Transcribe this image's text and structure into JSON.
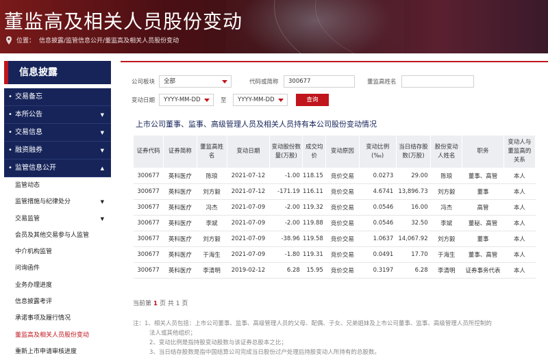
{
  "banner": {
    "title": "董监高及相关人员股份变动",
    "location_label": "位置：",
    "breadcrumb": "信息披露/监管信息公开/董监高及相关人员股份变动"
  },
  "sidebar": {
    "header": "信息披露",
    "main_items": [
      {
        "label": "交易备忘",
        "arrow": ""
      },
      {
        "label": "本所公告",
        "arrow": "▼"
      },
      {
        "label": "交易信息",
        "arrow": "▼"
      },
      {
        "label": "融资融券",
        "arrow": "▼"
      },
      {
        "label": "监管信息公开",
        "arrow": "▲"
      }
    ],
    "sub_items": [
      {
        "label": "监管动态",
        "arrow": ""
      },
      {
        "label": "监管措施与纪律处分",
        "arrow": "▼"
      },
      {
        "label": "交易监管",
        "arrow": "▼"
      },
      {
        "label": "会员及其他交易参与人监管",
        "arrow": ""
      },
      {
        "label": "中介机构监管",
        "arrow": ""
      },
      {
        "label": "问询函件",
        "arrow": ""
      },
      {
        "label": "业务办理进度",
        "arrow": ""
      },
      {
        "label": "信息披露考评",
        "arrow": ""
      },
      {
        "label": "承诺事项及履行情况",
        "arrow": ""
      },
      {
        "label": "董监高及相关人员股份变动",
        "arrow": ""
      },
      {
        "label": "重新上市申请审核进度",
        "arrow": ""
      }
    ],
    "active_sub": "董监高及相关人员股份变动"
  },
  "form": {
    "board_label": "公司板块",
    "board_value": "全部",
    "code_label": "代码或简称",
    "code_value": "300677",
    "name_label": "董监高姓名",
    "name_value": "",
    "date_label": "变动日期",
    "date_from": "YYYY-MM-DD",
    "to_label": "至",
    "date_to": "YYYY-MM-DD",
    "query_button": "查询"
  },
  "section_title": "上市公司董事、监事、高级管理人员及相关人员持有本公司股份变动情况",
  "table": {
    "headers": [
      "证券代码",
      "证券简称",
      "董监高姓名",
      "变动日期",
      "变动股份数量(万股)",
      "成交均价",
      "变动原因",
      "变动比例(‰)",
      "当日结存股数(万股)",
      "股份变动人姓名",
      "职务",
      "变动人与董监高的关系"
    ],
    "rows": [
      [
        "300677",
        "英科医疗",
        "陈琅",
        "2021-07-12",
        "-1.00",
        "118.15",
        "竞价交易",
        "0.0273",
        "29.00",
        "陈琅",
        "董事、高管",
        "本人"
      ],
      [
        "300677",
        "英科医疗",
        "刘方毅",
        "2021-07-12",
        "-171.19",
        "116.11",
        "竞价交易",
        "4.6741",
        "13,896.73",
        "刘方毅",
        "董事",
        "本人"
      ],
      [
        "300677",
        "英科医疗",
        "冯杰",
        "2021-07-09",
        "-2.00",
        "119.32",
        "竞价交易",
        "0.0546",
        "16.00",
        "冯杰",
        "高管",
        "本人"
      ],
      [
        "300677",
        "英科医疗",
        "李斌",
        "2021-07-09",
        "-2.00",
        "119.88",
        "竞价交易",
        "0.0546",
        "32.50",
        "李斌",
        "董秘、高管",
        "本人"
      ],
      [
        "300677",
        "英科医疗",
        "刘方毅",
        "2021-07-09",
        "-38.96",
        "119.58",
        "竞价交易",
        "1.0637",
        "14,067.92",
        "刘方毅",
        "董事",
        "本人"
      ],
      [
        "300677",
        "英科医疗",
        "于海生",
        "2021-07-09",
        "-1.80",
        "119.31",
        "竞价交易",
        "0.0491",
        "17.70",
        "于海生",
        "董事、高管",
        "本人"
      ],
      [
        "300677",
        "英科医疗",
        "李清明",
        "2019-02-12",
        "6.28",
        "15.95",
        "竞价交易",
        "0.3197",
        "6.28",
        "李清明",
        "证券事务代表",
        "本人"
      ]
    ]
  },
  "pager": {
    "prefix": "当前第",
    "current": "1",
    "mid": "页  共",
    "total": "1",
    "suffix": "页"
  },
  "notes": [
    "注：1、相关人员包括：上市公司董事、监事、高级管理人员的父母、配偶、子女、兄弟姐妹及上市公司董事、监事、高级管理人员所控制的",
    "法人或其他组织；",
    "2、变动比例是指持股变动股数与该证券总股本之比；",
    "3、当日结存股数是指中国结算公司完成当日股份过户处理后持股变动人所持有的总股数。"
  ],
  "colors": {
    "accent": "#c0151c",
    "navy": "#16245a"
  }
}
